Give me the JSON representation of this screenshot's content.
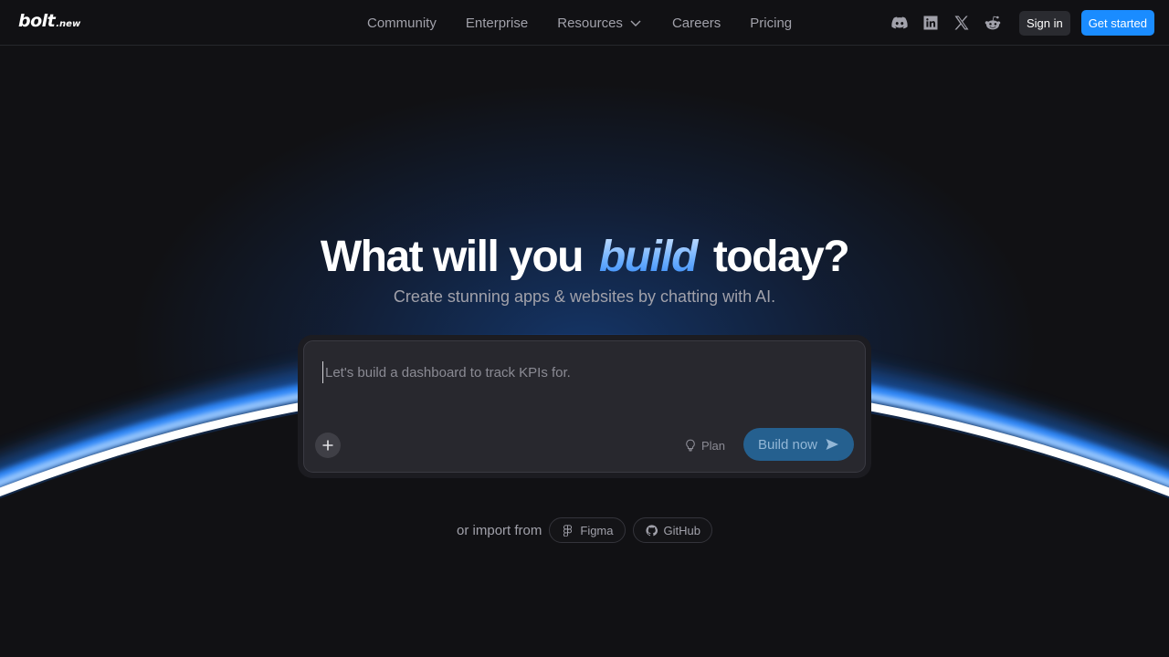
{
  "brand": {
    "name": "bolt",
    "suffix": ".new"
  },
  "nav": {
    "items": [
      {
        "label": "Community"
      },
      {
        "label": "Enterprise"
      },
      {
        "label": "Resources"
      },
      {
        "label": "Careers"
      },
      {
        "label": "Pricing"
      }
    ]
  },
  "header": {
    "social": [
      "discord-icon",
      "linkedin-icon",
      "x-icon",
      "reddit-icon"
    ],
    "signin_label": "Sign in",
    "get_started_label": "Get started"
  },
  "hero": {
    "title_before": "What will you",
    "title_accent": "build",
    "title_after": "today?",
    "subtitle": "Create stunning apps & websites by chatting with AI."
  },
  "prompt": {
    "placeholder": "Let's build a dashboard to track KPIs for.",
    "value": "",
    "plan_label": "Plan",
    "build_label": "Build now"
  },
  "import": {
    "label": "or import from",
    "figma_label": "Figma",
    "github_label": "GitHub"
  },
  "colors": {
    "background": "#111114",
    "accent": "#1a8cff",
    "build_button": "#25608f"
  }
}
